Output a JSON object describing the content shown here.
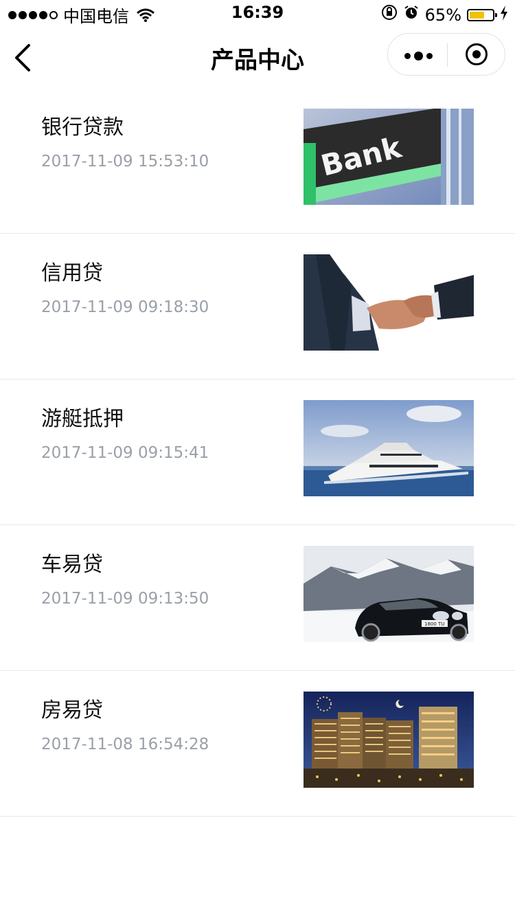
{
  "status_bar": {
    "carrier": "中国电信",
    "time": "16:39",
    "battery_percent_text": "65%",
    "battery_level": 0.65,
    "battery_color": "#f2c200"
  },
  "nav": {
    "title": "产品中心",
    "back_icon": "chevron-left-icon",
    "more_icon": "more-dots-icon",
    "home_icon": "target-icon"
  },
  "products": [
    {
      "title": "银行贷款",
      "time": "2017-11-09 15:53:10",
      "thumb_text": "Bank",
      "thumb_kind": "bank-sign"
    },
    {
      "title": "信用贷",
      "time": "2017-11-09 09:18:30",
      "thumb_kind": "handshake"
    },
    {
      "title": "游艇抵押",
      "time": "2017-11-09 09:15:41",
      "thumb_kind": "yacht"
    },
    {
      "title": "车易贷",
      "time": "2017-11-09 09:13:50",
      "thumb_text": "1800 TU",
      "thumb_kind": "car"
    },
    {
      "title": "房易贷",
      "time": "2017-11-08 16:54:28",
      "thumb_kind": "buildings-night"
    }
  ]
}
